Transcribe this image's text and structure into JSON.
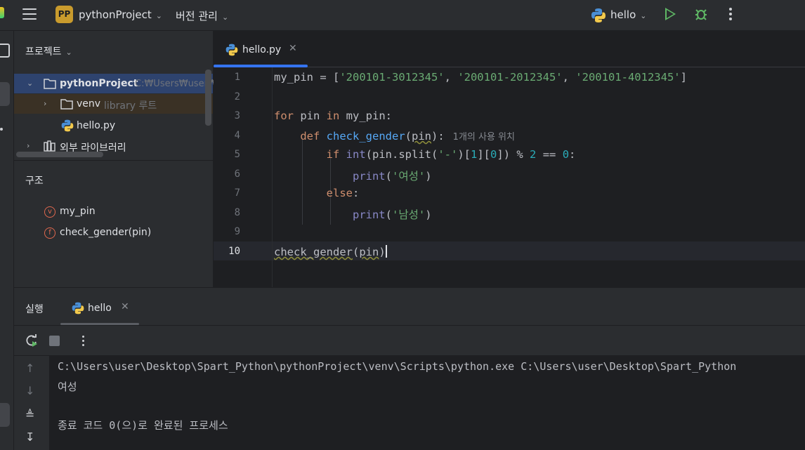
{
  "topbar": {
    "project_badge": "PP",
    "project_name": "pythonProject",
    "vcs_label": "버전 관리",
    "run_config": "hello"
  },
  "project_panel": {
    "title": "프로젝트",
    "tree": [
      {
        "name": "pythonProject",
        "path": "C:₩Users₩user₩"
      },
      {
        "name": "venv",
        "tag": "library 루트"
      },
      {
        "name": "hello.py"
      },
      {
        "name": "외부 라이브러리"
      }
    ]
  },
  "structure_panel": {
    "title": "구조",
    "items": [
      {
        "badge": "v",
        "label": "my_pin"
      },
      {
        "badge": "f",
        "label": "check_gender(pin)"
      }
    ]
  },
  "editor": {
    "tab_label": "hello.py",
    "line_numbers": [
      "1",
      "2",
      "3",
      "4",
      "5",
      "6",
      "7",
      "8",
      "9",
      "10"
    ],
    "usage_hint": "1개의 사용 위치",
    "code": {
      "l1_var": "my_pin = [",
      "l1_s1": "'200101-3012345'",
      "l1_s2": "'200101-2012345'",
      "l1_s3": "'200101-4012345'",
      "l3_for": "for",
      "l3_mid": " pin ",
      "l3_in": "in",
      "l3_end": " my_pin:",
      "l4_def": "def",
      "l4_fn": "check_gender",
      "l4_param": "pin",
      "l5_if": "if",
      "l5_int": "int",
      "l5_a": "(pin.split(",
      "l5_dash": "'-'",
      "l5_b": ")[",
      "l5_n1": "1",
      "l5_c": "][",
      "l5_n0": "0",
      "l5_d": "]) % ",
      "l5_n2": "2",
      "l5_e": " == ",
      "l5_n3": "0",
      "l5_f": ":",
      "l6_print": "print",
      "l6_str": "'여성'",
      "l7_else": "else",
      "l8_print": "print",
      "l8_str": "'남성'",
      "l10_fn": "check_gender",
      "l10_arg": "pin"
    }
  },
  "run_panel": {
    "title": "실행",
    "tab_label": "hello",
    "output": [
      "C:\\Users\\user\\Desktop\\Spart_Python\\pythonProject\\venv\\Scripts\\python.exe C:\\Users\\user\\Desktop\\Spart_Python",
      "여성",
      "",
      "종료 코드 0(으)로 완료된 프로세스"
    ]
  },
  "colors": {
    "accent": "#3574f0",
    "run_green": "#5fb865",
    "keyword": "#cf8e6d",
    "function": "#56a8f5",
    "string": "#6aab73",
    "number": "#2aacb8"
  }
}
